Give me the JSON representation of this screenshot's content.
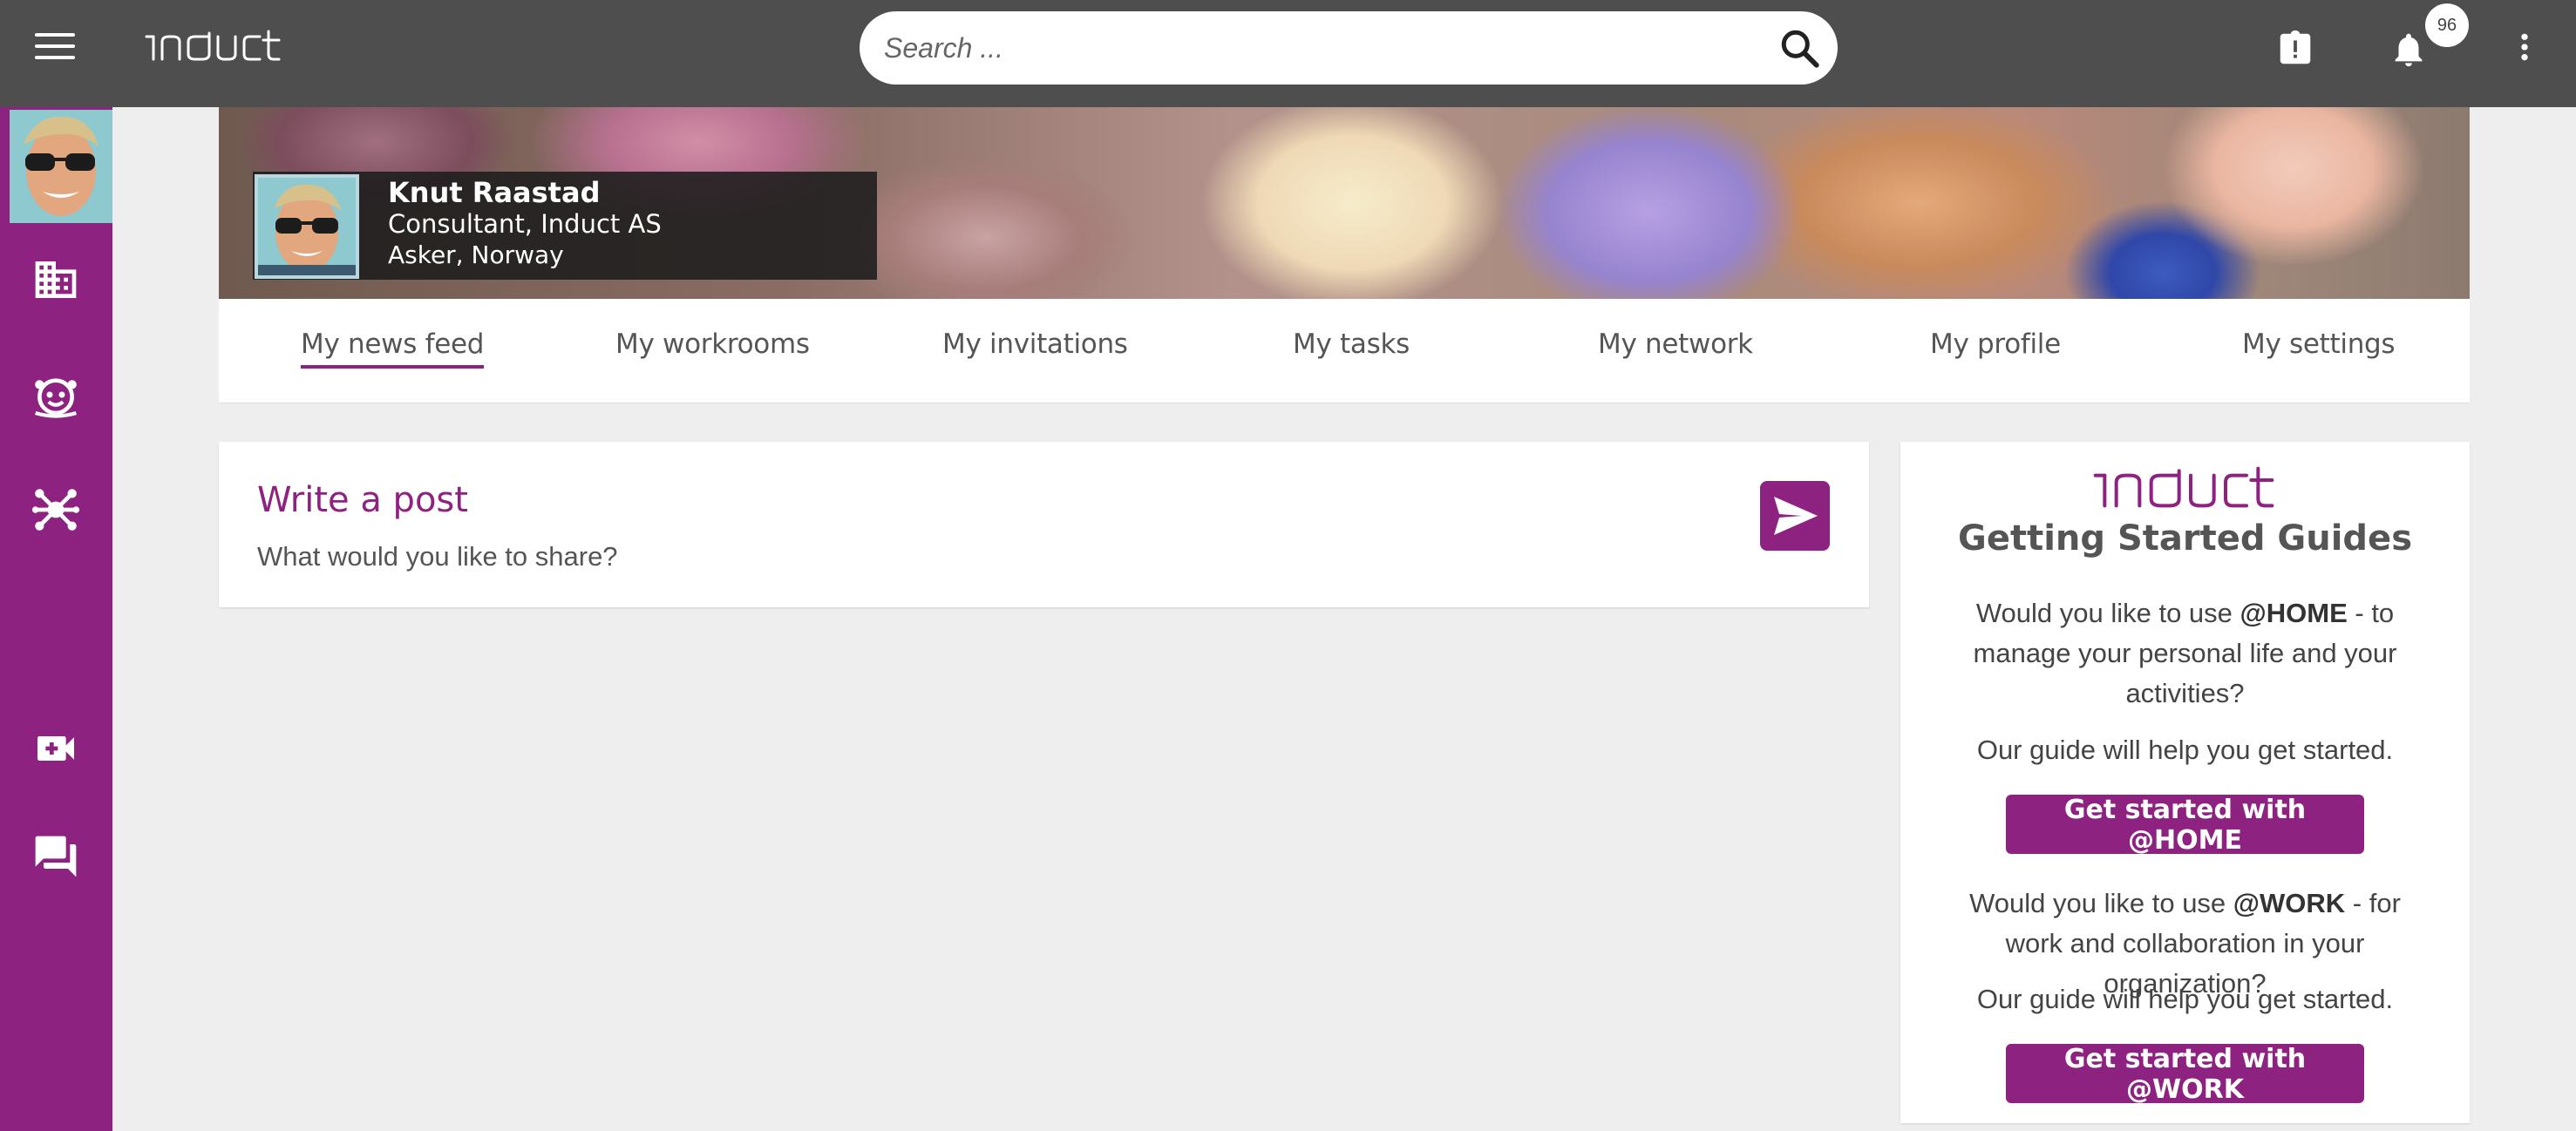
{
  "header": {
    "logo_text": "induct",
    "search": {
      "placeholder": "Search ...",
      "value": ""
    },
    "notification_count": "96"
  },
  "profile": {
    "name": "Knut Raastad",
    "role": "Consultant, Induct AS",
    "location": "Asker, Norway"
  },
  "tabs": [
    {
      "label": "My news feed",
      "active": true
    },
    {
      "label": "My workrooms"
    },
    {
      "label": "My invitations"
    },
    {
      "label": "My tasks"
    },
    {
      "label": "My network"
    },
    {
      "label": "My profile"
    },
    {
      "label": "My settings"
    }
  ],
  "post": {
    "title": "Write a post",
    "prompt": "What would you like to share?"
  },
  "guides": {
    "logo_text": "induct",
    "title": "Getting Started Guides",
    "home": {
      "text_before": "Would you like to use ",
      "keyword": "@HOME",
      "text_after": " - to manage your personal life and your activities?",
      "help": "Our guide will help you get started.",
      "button": "Get started with @HOME"
    },
    "work": {
      "text_before": "Would you like to use ",
      "keyword": "@WORK",
      "text_after": " - for work and collaboration in your organization?",
      "help": "Our guide will help you get started.",
      "button": "Get started with @WORK"
    }
  },
  "colors": {
    "accent": "#8e2281",
    "topbar": "#4e4e4e",
    "background": "#efeeef"
  },
  "icons": {
    "rail": [
      "building-icon",
      "face-icon",
      "network-icon",
      "video-add-icon",
      "chat-icon"
    ],
    "topbar": [
      "menu-icon",
      "search-icon",
      "clipboard-alert-icon",
      "bell-icon",
      "more-vertical-icon"
    ]
  }
}
